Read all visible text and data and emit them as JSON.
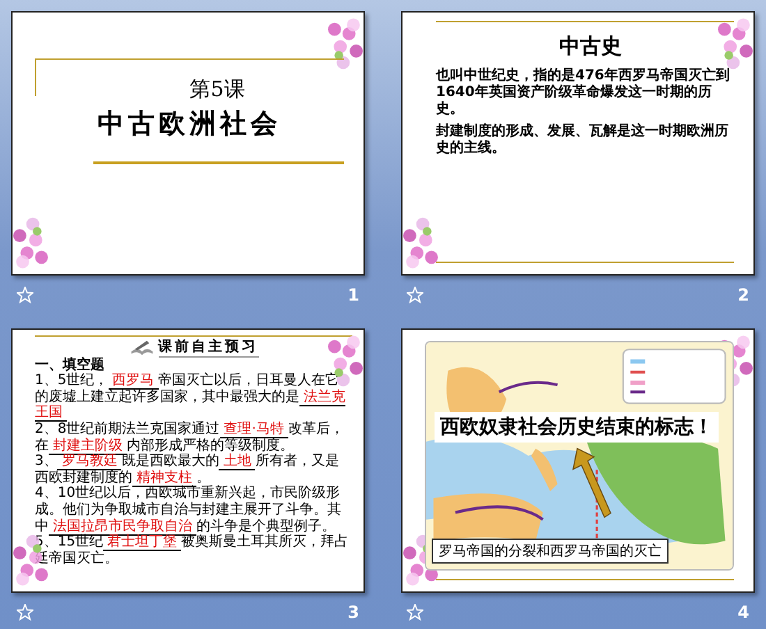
{
  "slides": [
    {
      "number": "1",
      "kind": "title",
      "lesson": "第5课",
      "title": "中古欧洲社会"
    },
    {
      "number": "2",
      "kind": "text",
      "heading": "中古史",
      "paragraphs": [
        "也叫中世纪史，指的是476年西罗马帝国灭亡到1640年英国资产阶级革命爆发这一时期的历史。",
        "封建制度的形成、发展、瓦解是这一时期欧洲历史的主线。"
      ]
    },
    {
      "number": "3",
      "kind": "exercise",
      "banner": "课前自主预习",
      "section": "一、填空题",
      "items": [
        [
          {
            "kind": "text",
            "text": "1、5世纪，"
          },
          {
            "kind": "blank",
            "answer": "西罗马"
          },
          {
            "kind": "text",
            "text": "帝国灭亡以后，日耳曼人在它的废墟上建立起许多国家，其中最强大的是"
          },
          {
            "kind": "blank",
            "answer": "法兰克王国"
          }
        ],
        [
          {
            "kind": "text",
            "text": "2、8世纪前期法兰克国家通过"
          },
          {
            "kind": "blank",
            "answer": "查理·马特"
          },
          {
            "kind": "text",
            "text": "改革后，在"
          },
          {
            "kind": "blank",
            "answer": "封建主阶级"
          },
          {
            "kind": "text",
            "text": "内部形成严格的等级制度。"
          }
        ],
        [
          {
            "kind": "text",
            "text": "3、"
          },
          {
            "kind": "blank",
            "answer": "罗马教廷"
          },
          {
            "kind": "text",
            "text": "既是西欧最大的"
          },
          {
            "kind": "blank",
            "answer": "土地"
          },
          {
            "kind": "text",
            "text": "所有者，又是西欧封建制度的"
          },
          {
            "kind": "blank",
            "answer": "精神支柱"
          },
          {
            "kind": "text",
            "text": "。"
          }
        ],
        [
          {
            "kind": "text",
            "text": "4、10世纪以后，西欧城市重新兴起，市民阶级形成。他们为争取城市自治与封建主展开了斗争。其中"
          },
          {
            "kind": "blank",
            "answer": "法国拉昂市民争取自治"
          },
          {
            "kind": "text",
            "text": "的斗争是个典型例子。"
          }
        ],
        [
          {
            "kind": "text",
            "text": "5、15世纪"
          },
          {
            "kind": "blank",
            "answer": "君士坦丁堡"
          },
          {
            "kind": "text",
            "text": "被奥斯曼土耳其所灭，拜占廷帝国灭亡。"
          }
        ]
      ]
    },
    {
      "number": "4",
      "kind": "map",
      "callout": "西欧奴隶社会历史结束的标志！",
      "caption": "罗马帝国的分裂和西罗马帝国的灭亡"
    }
  ]
}
